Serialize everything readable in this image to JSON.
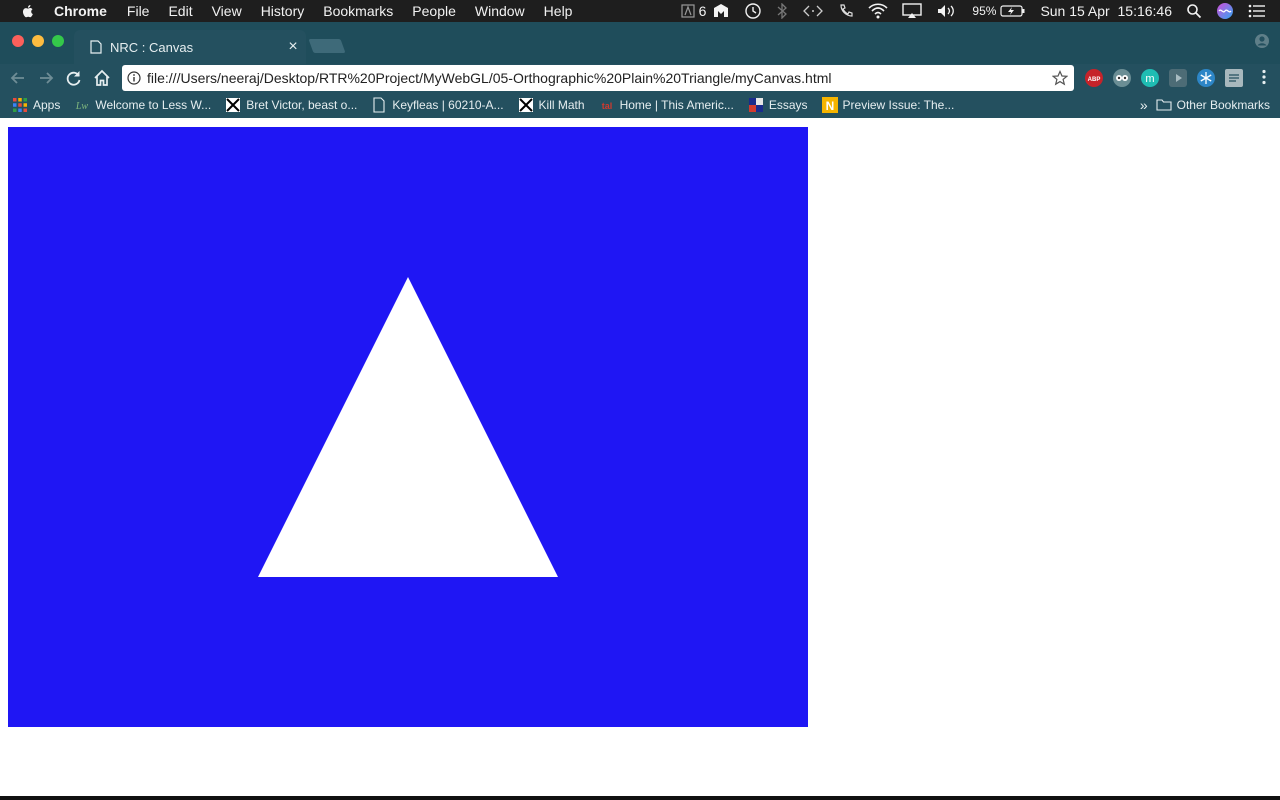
{
  "menubar": {
    "app_name": "Chrome",
    "items": [
      "File",
      "Edit",
      "View",
      "History",
      "Bookmarks",
      "People",
      "Window",
      "Help"
    ],
    "tray": {
      "notification_count": "6",
      "battery": "95%",
      "datetime": "Sun 15 Apr  15:16:46"
    }
  },
  "browser": {
    "tab_title": "NRC : Canvas",
    "url": "file:///Users/neeraj/Desktop/RTR%20Project/MyWebGL/05-Orthographic%20Plain%20Triangle/myCanvas.html"
  },
  "bookmarks": {
    "items": [
      "Apps",
      "Welcome to Less W...",
      "Bret Victor, beast o...",
      "Keyfleas | 60210-A...",
      "Kill Math",
      "Home | This Americ...",
      "Essays",
      "Preview Issue: The..."
    ],
    "other": "Other Bookmarks"
  },
  "canvas": {
    "background_color": "#1f16f4",
    "shape": "triangle",
    "shape_color": "#ffffff"
  },
  "colors": {
    "menubar": "#1e1e1e",
    "chrome_frame": "#1f4d5b",
    "toolbar": "#24505f"
  }
}
